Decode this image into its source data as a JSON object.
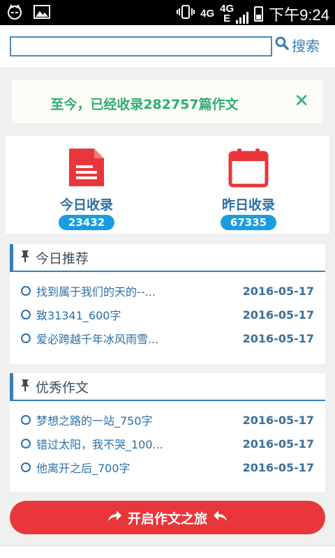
{
  "status_bar": {
    "left_icons": [
      "cat-face-icon",
      "image-icon"
    ],
    "right_icons": [
      "vibrate-icon",
      "signal-4g-icon",
      "signal-4g-e-icon",
      "battery-icon"
    ],
    "net1": "4G",
    "net2_top": "4G",
    "net2_bottom": "E",
    "time": "下午9:24"
  },
  "search": {
    "placeholder": "",
    "button_label": "搜索",
    "button_icon": "search-icon"
  },
  "notice": {
    "text": "至今，已经收录282757篇作文",
    "close_label": "✕",
    "accent": "#2eae72"
  },
  "stats": {
    "today": {
      "label": "今日收录",
      "count": "23432",
      "icon": "document-icon"
    },
    "yesterday": {
      "label": "昨日收录",
      "count": "67335",
      "icon": "calendar-icon"
    }
  },
  "sections": {
    "recommend": {
      "title": "今日推荐",
      "icon": "pin-icon",
      "items": [
        {
          "title": "找到属于我们的天的--...",
          "date": "2016-05-17"
        },
        {
          "title": "致31341_600字",
          "date": "2016-05-17"
        },
        {
          "title": "爱必跨越千年冰风雨雪...",
          "date": "2016-05-17"
        }
      ]
    },
    "excellent": {
      "title": "优秀作文",
      "icon": "pin-icon",
      "items": [
        {
          "title": "梦想之路的一站_750字",
          "date": "2016-05-17"
        },
        {
          "title": "错过太阳，我不哭_100...",
          "date": "2016-05-17"
        },
        {
          "title": "他离开之后_700字",
          "date": "2016-05-17"
        }
      ]
    }
  },
  "cta": {
    "label": "开启作文之旅",
    "color": "#e8363a"
  }
}
